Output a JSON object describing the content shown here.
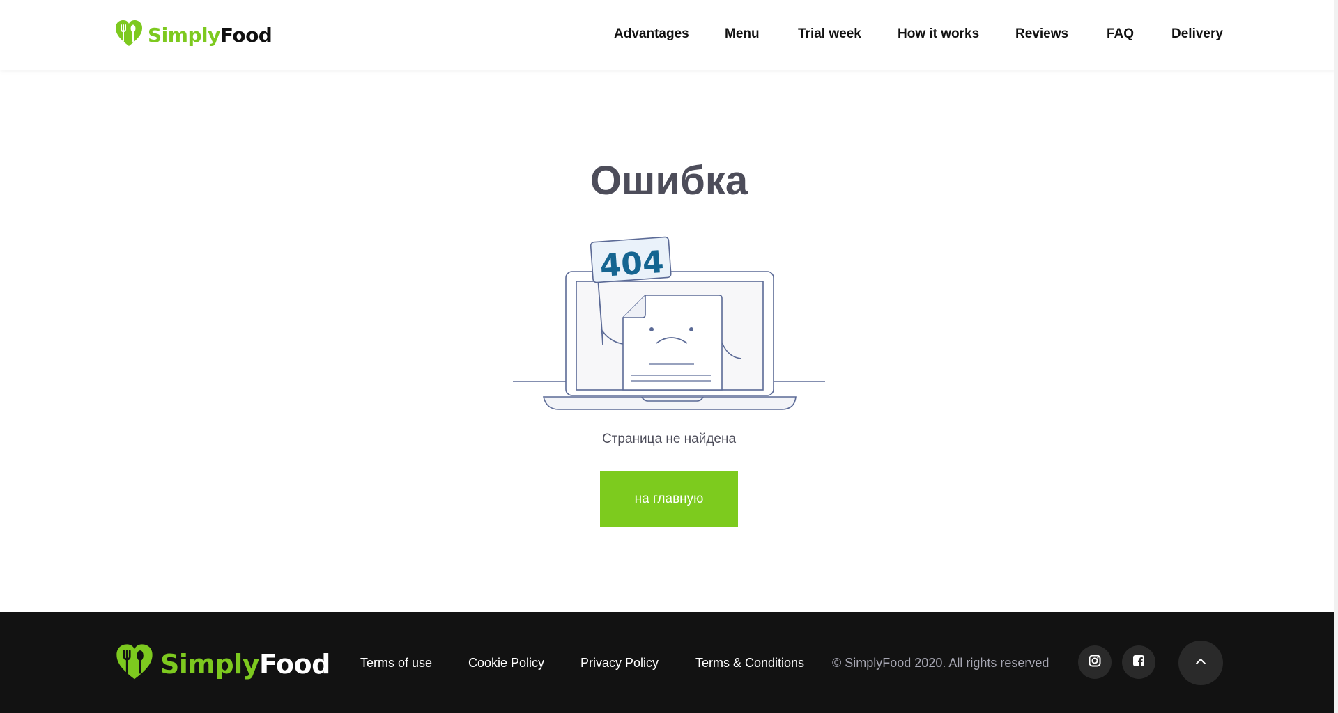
{
  "brand": {
    "simply": "Simply",
    "food": "Food"
  },
  "nav": {
    "items": [
      {
        "label": "Advantages"
      },
      {
        "label": "Menu"
      },
      {
        "label": "Trial week"
      },
      {
        "label": "How it works"
      },
      {
        "label": "Reviews"
      },
      {
        "label": "FAQ"
      },
      {
        "label": "Delivery"
      }
    ]
  },
  "error": {
    "title": "Ошибка",
    "code": "404",
    "message": "Страница не найдена",
    "button_label": "на главную"
  },
  "footer": {
    "links": [
      {
        "label": "Terms of use"
      },
      {
        "label": "Cookie Policy"
      },
      {
        "label": "Privacy Policy"
      },
      {
        "label": "Terms & Conditions"
      }
    ],
    "copyright": "© SimplyFood 2020. All rights reserved",
    "social": [
      {
        "icon": "instagram-icon"
      },
      {
        "icon": "facebook-icon"
      }
    ],
    "scroll_top_icon": "chevron-up-icon"
  },
  "colors": {
    "accent": "#7dcb1e",
    "heading": "#4d4d5a",
    "footer_bg": "#121212",
    "illustration_line": "#5b6a96",
    "code_text": "#156591"
  }
}
